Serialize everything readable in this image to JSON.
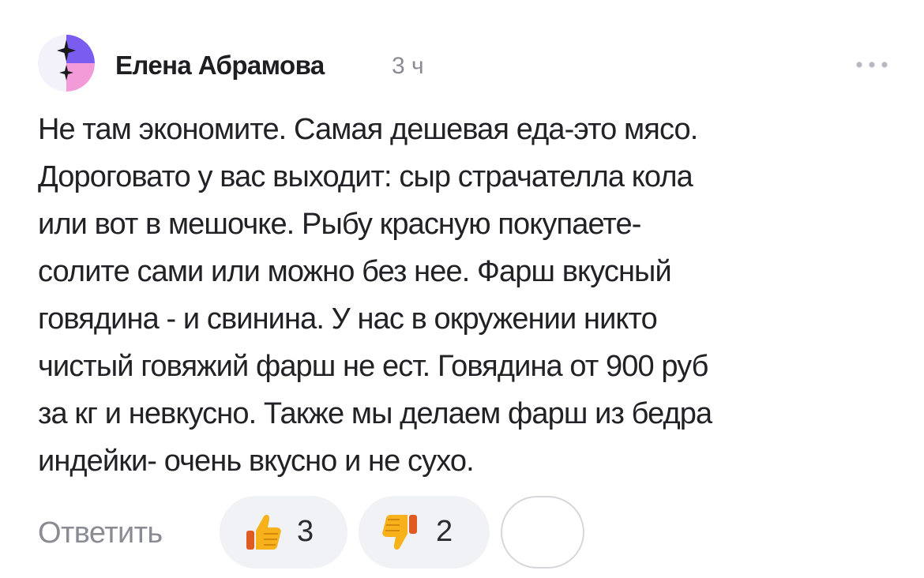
{
  "comment": {
    "author": "Елена Абрамова",
    "time": "3 ч",
    "text_lines": [
      "Не там экономите. Самая дешевая еда-это мясо.",
      "Дороговато у вас выходит: сыр страчателла  кола",
      "или вот в мешочке. Рыбу красную покупаете-",
      "солите сами или можно без нее. Фарш вкусный",
      "говядина - и свинина. У нас в окружении никто",
      "чистый говяжий фарш не ест. Говядина от 900 руб",
      "за кг и невкусно. Также мы делаем фарш из бедра",
      "индейки- очень вкусно и не сухо."
    ]
  },
  "actions": {
    "reply_label": "Ответить",
    "likes": "3",
    "dislikes": "2"
  },
  "icons": {
    "avatar": "avatar-sparkle-icon",
    "more": "more-dots-icon",
    "like": "thumbs-up-icon",
    "dislike": "thumbs-down-icon",
    "add_reaction": "add-reaction-icon"
  },
  "colors": {
    "text": "#212126",
    "muted": "#8b8b94",
    "pill_bg": "#f1f2f5",
    "avatar_purple": "#7b5cf0",
    "avatar_pink": "#f39ad8",
    "thumb_yellow": "#f7b21b"
  }
}
